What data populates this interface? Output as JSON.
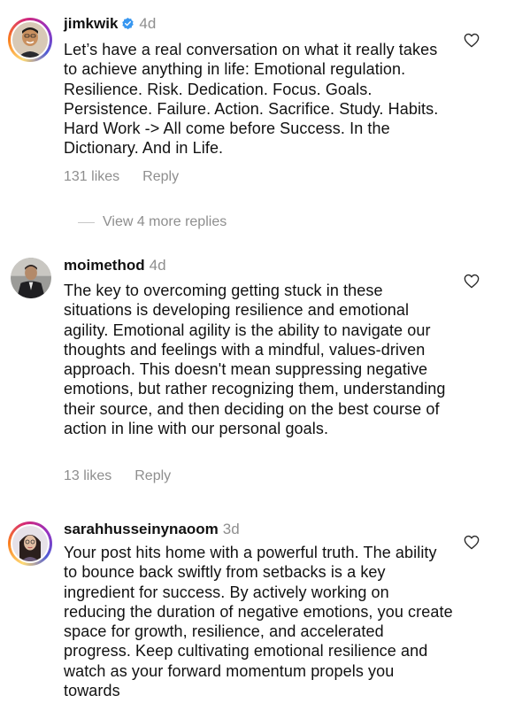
{
  "comments": [
    {
      "username": "jimkwik",
      "verified": true,
      "time": "4d",
      "text": "Let’s have a real conversation on what it really takes to achieve anything in life: Emotional regulation. Resilience. Risk. Dedication. Focus. Goals. Persistence. Failure. Action. Sacrifice. Study. Habits. Hard Work -> All come before Success. In the Dictionary. And in Life.",
      "likes": "131 likes",
      "reply_label": "Reply",
      "view_replies": "View 4 more replies"
    },
    {
      "username": "moimethod",
      "verified": false,
      "time": "4d",
      "text": "The key to overcoming getting stuck in these situations is developing resilience and emotional agility. Emotional agility is the ability to navigate our thoughts and feelings with a mindful, values-driven approach. This doesn't mean suppressing negative emotions, but rather recognizing them, understanding their source, and then deciding on the best course of action in line with our personal goals.",
      "likes": "13 likes",
      "reply_label": "Reply"
    },
    {
      "username": "sarahhusseinynaoom",
      "verified": false,
      "time": "3d",
      "text": "Your post hits home with a powerful truth. The ability to bounce back swiftly from setbacks is a key ingredient for success. By actively working on reducing the duration of negative emotions, you create space for growth, resilience, and accelerated progress. Keep cultivating emotional resilience and watch as your forward momentum propels you towards"
    }
  ],
  "icons": {
    "like": "heart-outline-icon",
    "verified": "verified-badge-icon"
  },
  "colors": {
    "text": "#111111",
    "secondary": "#8e8e8e",
    "verified": "#3897f0"
  }
}
